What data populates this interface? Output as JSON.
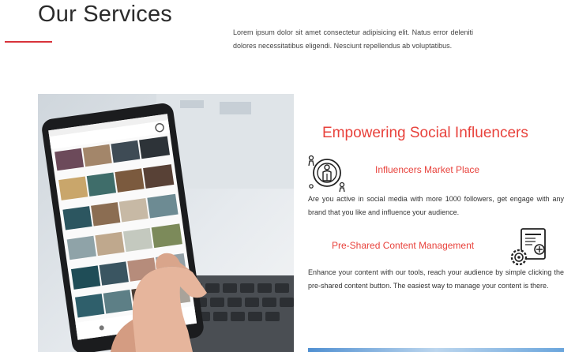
{
  "section": {
    "title": "Our Services",
    "intro": "Lorem ipsum dolor sit amet consectetur adipisicing elit. Natus error deleniti dolores necessitatibus eligendi. Nesciunt repellendus ab voluptatibus."
  },
  "services": {
    "heading": "Empowering Social Influencers",
    "items": [
      {
        "title": "Influencers Market Place",
        "description": "Are you active in social media with more 1000 followers, get engage with any brand that you like and influence your audience.",
        "icon": "influencer-person-icon"
      },
      {
        "title": "Pre-Shared Content Management",
        "description": "Enhance your content with our tools, reach your audience by simple clicking the pre-shared content button. The easiest way to manage your content is there.",
        "icon": "document-gear-icon"
      }
    ]
  },
  "colors": {
    "accent": "#e8423c",
    "underline": "#d8333a",
    "title": "#2b2b2b"
  }
}
